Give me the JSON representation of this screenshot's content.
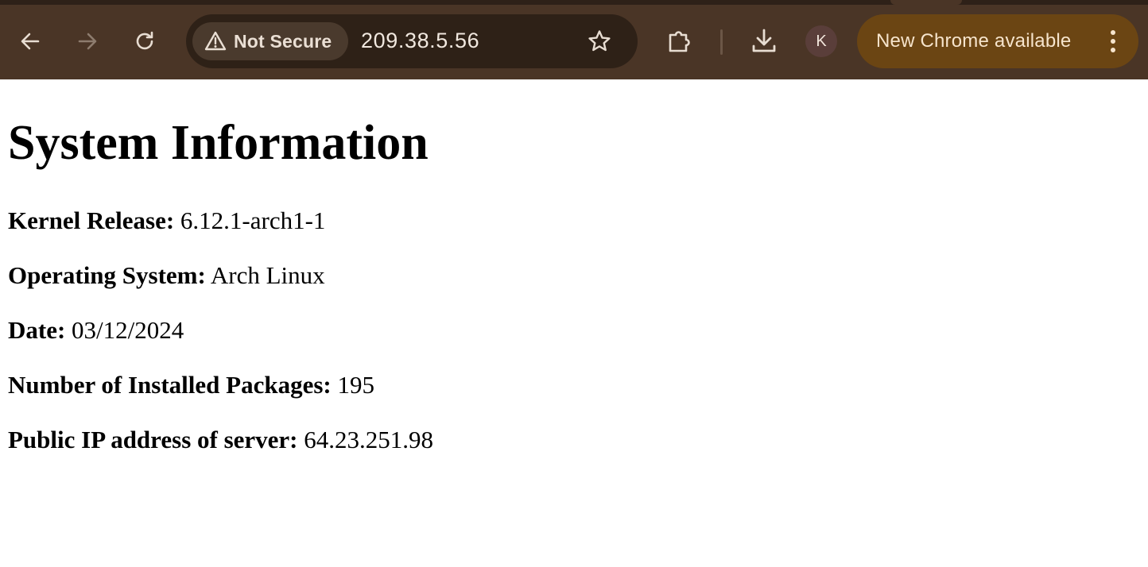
{
  "browser": {
    "security_label": "Not Secure",
    "url": "209.38.5.56",
    "profile_initial": "K",
    "update_label": "New Chrome available",
    "icons": {
      "back": "arrow-left-icon",
      "forward": "arrow-right-icon",
      "reload": "reload-icon",
      "security": "warning-triangle-icon",
      "bookmark": "star-icon",
      "extensions": "puzzle-icon",
      "downloads": "download-icon",
      "menu": "three-dots-vertical-icon"
    },
    "colors": {
      "toolbar": "#4a3526",
      "omnibox": "#2e2117",
      "update_chip": "#6b4513"
    }
  },
  "page": {
    "title": "System Information",
    "rows": [
      {
        "label": "Kernel Release:",
        "value": "6.12.1-arch1-1"
      },
      {
        "label": "Operating System:",
        "value": "Arch Linux"
      },
      {
        "label": "Date:",
        "value": "03/12/2024"
      },
      {
        "label": "Number of Installed Packages:",
        "value": "195"
      },
      {
        "label": "Public IP address of server:",
        "value": "64.23.251.98"
      }
    ]
  }
}
